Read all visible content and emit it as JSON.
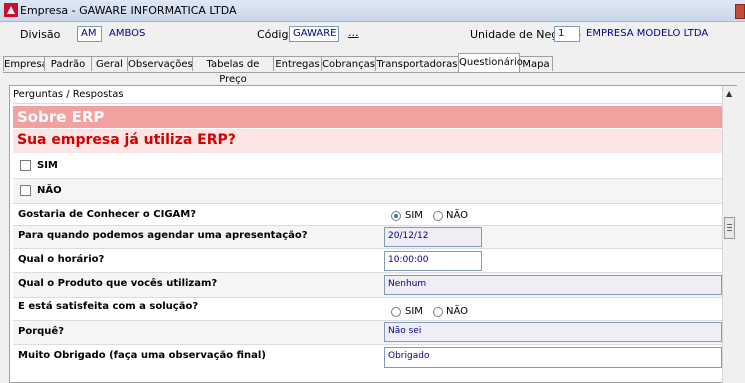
{
  "window": {
    "title": "Empresa - GAWARE INFORMATICA LTDA"
  },
  "header": {
    "divisao_label": "Divisão",
    "divisao_code": "AM",
    "divisao_name": "AMBOS",
    "codigo_label": "Código",
    "codigo_value": "GAWARE",
    "codigo_lookup": "...",
    "unidade_label": "Unidade de Negócio",
    "unidade_code": "1",
    "unidade_name": "EMPRESA MODELO LTDA"
  },
  "tabs": [
    {
      "label": "Empresa"
    },
    {
      "label": "Padrão"
    },
    {
      "label": "Geral"
    },
    {
      "label": "Observações"
    },
    {
      "label": "Tabelas de Preço"
    },
    {
      "label": "Entregas"
    },
    {
      "label": "Cobranças"
    },
    {
      "label": "Transportadoras"
    },
    {
      "label": "Questionário"
    },
    {
      "label": "Mapa"
    }
  ],
  "active_tab": "Questionário",
  "panel": {
    "header": "Perguntas / Respostas",
    "section_title": "Sobre ERP",
    "section_question": "Sua empresa já utiliza ERP?",
    "options": [
      {
        "label": "SIM",
        "checked": false
      },
      {
        "label": "NÃO",
        "checked": false
      }
    ],
    "questions": [
      {
        "text": "Gostaria de Conhecer o CIGAM?",
        "radio_sim": "SIM",
        "radio_nao": "NÃO",
        "selected": "SIM"
      },
      {
        "text": "Para quando podemos agendar uma apresentação?",
        "answer": "20/12/12"
      },
      {
        "text": "Qual o horário?",
        "answer": "10:00:00"
      },
      {
        "text": "Qual o Produto que vocês utilizam?",
        "answer": "Nenhum"
      },
      {
        "text": "E está  satisfeita com a solução?",
        "radio_sim": "SIM",
        "radio_nao": "NÃO",
        "selected": "none"
      },
      {
        "text": "Porquê?",
        "answer": "Não sei"
      },
      {
        "text": "Muito Obrigado (faça uma observação final)",
        "answer": "Obrigado"
      }
    ]
  },
  "colors": {
    "section_bg": "#f2a0a0",
    "question_red": "#d40000",
    "value_blue": "#00008b"
  }
}
